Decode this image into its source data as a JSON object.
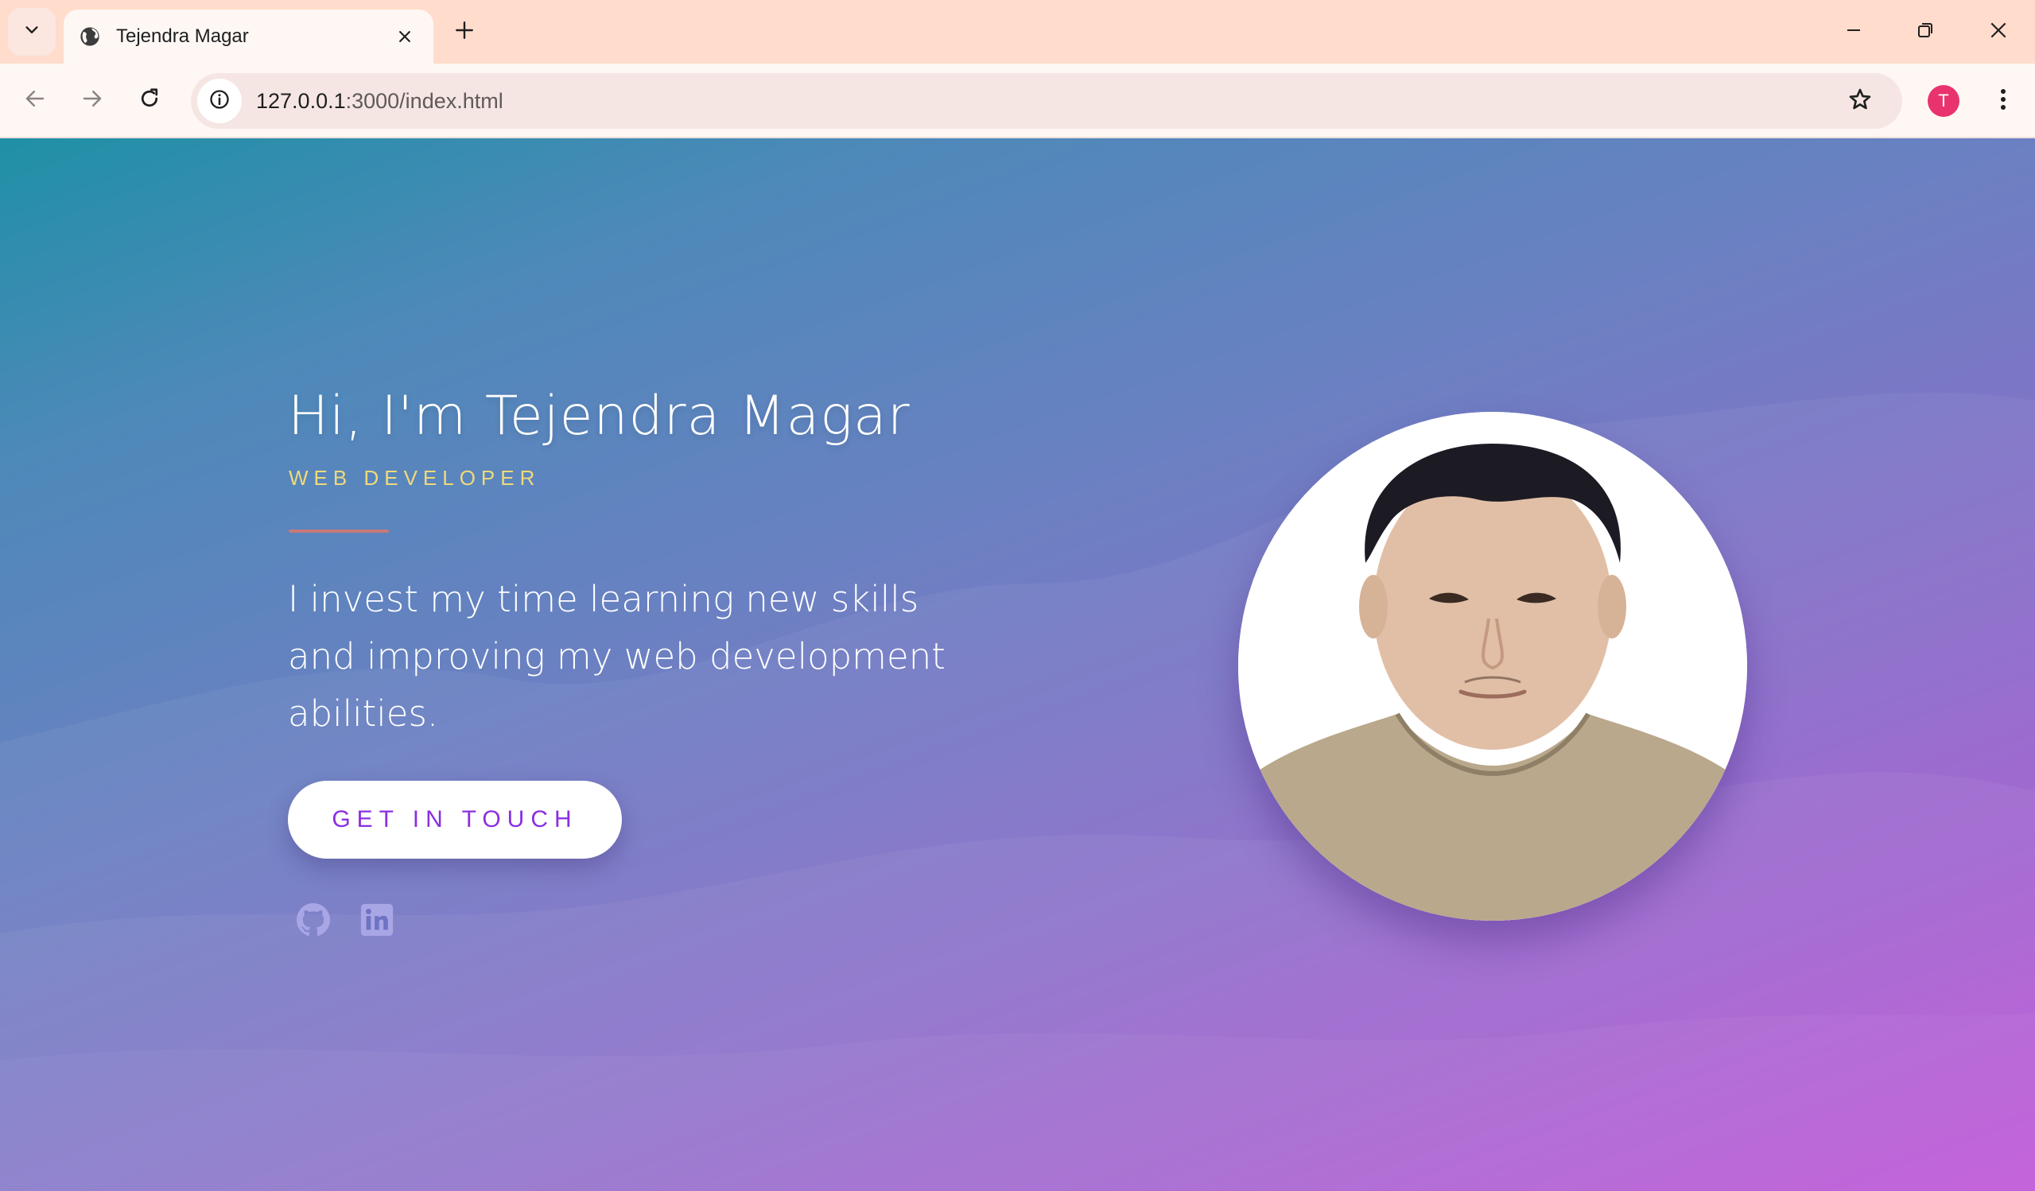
{
  "browser": {
    "tab_title": "Tejendra Magar",
    "url_host": "127.0.0.1",
    "url_rest": ":3000/index.html",
    "profile_initial": "T",
    "colors": {
      "tabbar": "#ffdccc",
      "toolbar": "#fff7f4",
      "omnibox": "#f6e6e3",
      "profile": "#e8336f"
    }
  },
  "hero": {
    "name": "Hi, I'm Tejendra Magar",
    "role": "WEB DEVELOPER",
    "description": "I invest my time learning new skills and improving my web development abilities.",
    "cta_label": "GET IN TOUCH",
    "social": [
      "github-icon",
      "linkedin-icon"
    ],
    "colors": {
      "role": "#f0d97a",
      "divider": "#c97a7a",
      "cta_text": "#8b2fe0"
    }
  }
}
